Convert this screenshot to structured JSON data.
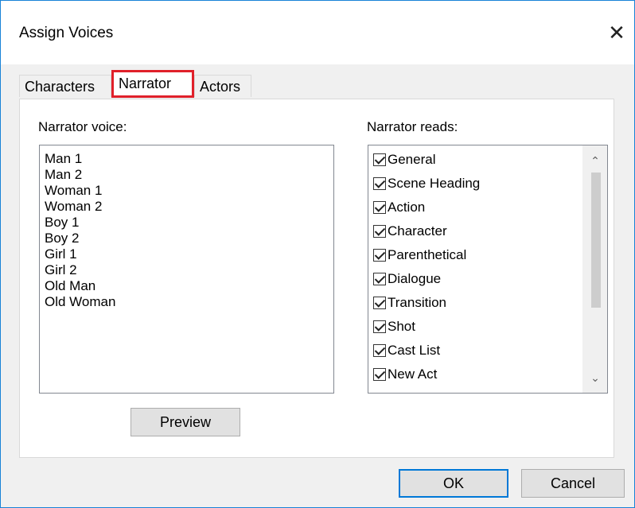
{
  "window": {
    "title": "Assign Voices",
    "close_glyph": "✕"
  },
  "tabs": [
    {
      "label": "Characters"
    },
    {
      "label": "Narrator",
      "active": true
    },
    {
      "label": "Actors"
    }
  ],
  "narrator_voice": {
    "label": "Narrator voice:",
    "items": [
      "Man 1",
      "Man 2",
      "Woman 1",
      "Woman 2",
      "Boy 1",
      "Boy 2",
      "Girl 1",
      "Girl 2",
      "Old Man",
      "Old Woman"
    ]
  },
  "narrator_reads": {
    "label": "Narrator reads:",
    "items": [
      {
        "label": "General",
        "checked": true
      },
      {
        "label": "Scene Heading",
        "checked": true
      },
      {
        "label": "Action",
        "checked": true
      },
      {
        "label": "Character",
        "checked": true
      },
      {
        "label": "Parenthetical",
        "checked": true
      },
      {
        "label": "Dialogue",
        "checked": true
      },
      {
        "label": "Transition",
        "checked": true
      },
      {
        "label": "Shot",
        "checked": true
      },
      {
        "label": "Cast List",
        "checked": true
      },
      {
        "label": "New Act",
        "checked": true
      }
    ],
    "scroll_up_glyph": "⌃",
    "scroll_down_glyph": "⌄"
  },
  "buttons": {
    "preview": "Preview",
    "ok": "OK",
    "cancel": "Cancel"
  },
  "colors": {
    "tab_highlight": "#e0202a",
    "default_button_border": "#0078d7"
  }
}
